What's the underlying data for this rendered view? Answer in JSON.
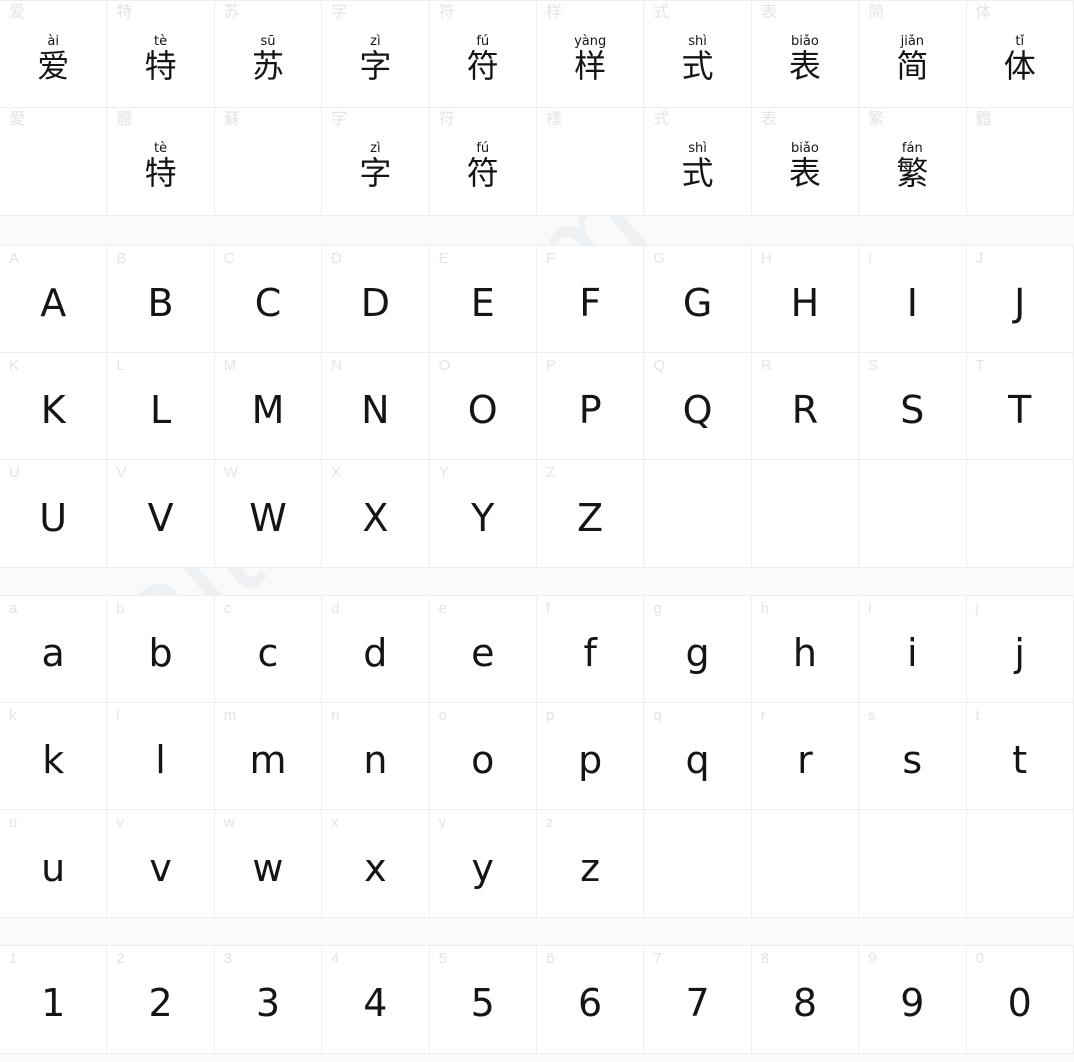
{
  "watermark": {
    "text": "aitesu.com"
  },
  "colors": {
    "page_background": "#fafafa",
    "cell_background": "#ffffff",
    "grid_line": "#eceef0",
    "index_label": "#e2e4e6",
    "glyph": "#151515",
    "watermark": "#eef1f4"
  },
  "sections": [
    {
      "name": "sample-phrase",
      "rows": [
        [
          {
            "index": "爱",
            "pinyin": "ài",
            "hanzi": "爱"
          },
          {
            "index": "特",
            "pinyin": "tè",
            "hanzi": "特"
          },
          {
            "index": "苏",
            "pinyin": "sū",
            "hanzi": "苏"
          },
          {
            "index": "字",
            "pinyin": "zì",
            "hanzi": "字"
          },
          {
            "index": "符",
            "pinyin": "fú",
            "hanzi": "符"
          },
          {
            "index": "样",
            "pinyin": "yàng",
            "hanzi": "样"
          },
          {
            "index": "式",
            "pinyin": "shì",
            "hanzi": "式"
          },
          {
            "index": "表",
            "pinyin": "biǎo",
            "hanzi": "表"
          },
          {
            "index": "简",
            "pinyin": "jiǎn",
            "hanzi": "简"
          },
          {
            "index": "体",
            "pinyin": "tǐ",
            "hanzi": "体"
          }
        ],
        [
          {
            "index": "愛",
            "pinyin": "",
            "hanzi": ""
          },
          {
            "index": "體",
            "pinyin": "tè",
            "hanzi": "特"
          },
          {
            "index": "蘇",
            "pinyin": "",
            "hanzi": ""
          },
          {
            "index": "字",
            "pinyin": "zì",
            "hanzi": "字"
          },
          {
            "index": "符",
            "pinyin": "fú",
            "hanzi": "符"
          },
          {
            "index": "樣",
            "pinyin": "",
            "hanzi": ""
          },
          {
            "index": "式",
            "pinyin": "shì",
            "hanzi": "式"
          },
          {
            "index": "表",
            "pinyin": "biǎo",
            "hanzi": "表"
          },
          {
            "index": "繁",
            "pinyin": "fán",
            "hanzi": "繁"
          },
          {
            "index": "體",
            "pinyin": "",
            "hanzi": ""
          }
        ]
      ]
    },
    {
      "name": "uppercase-latin",
      "rows": [
        [
          {
            "index": "A",
            "glyph": "A"
          },
          {
            "index": "B",
            "glyph": "B"
          },
          {
            "index": "C",
            "glyph": "C"
          },
          {
            "index": "D",
            "glyph": "D"
          },
          {
            "index": "E",
            "glyph": "E"
          },
          {
            "index": "F",
            "glyph": "F"
          },
          {
            "index": "G",
            "glyph": "G"
          },
          {
            "index": "H",
            "glyph": "H"
          },
          {
            "index": "I",
            "glyph": "I"
          },
          {
            "index": "J",
            "glyph": "J"
          }
        ],
        [
          {
            "index": "K",
            "glyph": "K"
          },
          {
            "index": "L",
            "glyph": "L"
          },
          {
            "index": "M",
            "glyph": "M"
          },
          {
            "index": "N",
            "glyph": "N"
          },
          {
            "index": "O",
            "glyph": "O"
          },
          {
            "index": "P",
            "glyph": "P"
          },
          {
            "index": "Q",
            "glyph": "Q"
          },
          {
            "index": "R",
            "glyph": "R"
          },
          {
            "index": "S",
            "glyph": "S"
          },
          {
            "index": "T",
            "glyph": "T"
          }
        ],
        [
          {
            "index": "U",
            "glyph": "U"
          },
          {
            "index": "V",
            "glyph": "V"
          },
          {
            "index": "W",
            "glyph": "W"
          },
          {
            "index": "X",
            "glyph": "X"
          },
          {
            "index": "Y",
            "glyph": "Y"
          },
          {
            "index": "Z",
            "glyph": "Z"
          },
          {
            "index": "",
            "glyph": ""
          },
          {
            "index": "",
            "glyph": ""
          },
          {
            "index": "",
            "glyph": ""
          },
          {
            "index": "",
            "glyph": ""
          }
        ]
      ]
    },
    {
      "name": "lowercase-latin",
      "rows": [
        [
          {
            "index": "a",
            "glyph": "a"
          },
          {
            "index": "b",
            "glyph": "b"
          },
          {
            "index": "c",
            "glyph": "c"
          },
          {
            "index": "d",
            "glyph": "d"
          },
          {
            "index": "e",
            "glyph": "e"
          },
          {
            "index": "f",
            "glyph": "f"
          },
          {
            "index": "g",
            "glyph": "g"
          },
          {
            "index": "h",
            "glyph": "h"
          },
          {
            "index": "i",
            "glyph": "i"
          },
          {
            "index": "j",
            "glyph": "j"
          }
        ],
        [
          {
            "index": "k",
            "glyph": "k"
          },
          {
            "index": "l",
            "glyph": "l"
          },
          {
            "index": "m",
            "glyph": "m"
          },
          {
            "index": "n",
            "glyph": "n"
          },
          {
            "index": "o",
            "glyph": "o"
          },
          {
            "index": "p",
            "glyph": "p"
          },
          {
            "index": "q",
            "glyph": "q"
          },
          {
            "index": "r",
            "glyph": "r"
          },
          {
            "index": "s",
            "glyph": "s"
          },
          {
            "index": "t",
            "glyph": "t"
          }
        ],
        [
          {
            "index": "u",
            "glyph": "u"
          },
          {
            "index": "v",
            "glyph": "v"
          },
          {
            "index": "w",
            "glyph": "w"
          },
          {
            "index": "x",
            "glyph": "x"
          },
          {
            "index": "y",
            "glyph": "y"
          },
          {
            "index": "z",
            "glyph": "z"
          },
          {
            "index": "",
            "glyph": ""
          },
          {
            "index": "",
            "glyph": ""
          },
          {
            "index": "",
            "glyph": ""
          },
          {
            "index": "",
            "glyph": ""
          }
        ]
      ]
    },
    {
      "name": "digits",
      "rows": [
        [
          {
            "index": "1",
            "glyph": "1"
          },
          {
            "index": "2",
            "glyph": "2"
          },
          {
            "index": "3",
            "glyph": "3"
          },
          {
            "index": "4",
            "glyph": "4"
          },
          {
            "index": "5",
            "glyph": "5"
          },
          {
            "index": "6",
            "glyph": "6"
          },
          {
            "index": "7",
            "glyph": "7"
          },
          {
            "index": "8",
            "glyph": "8"
          },
          {
            "index": "9",
            "glyph": "9"
          },
          {
            "index": "0",
            "glyph": "0"
          }
        ]
      ]
    }
  ]
}
